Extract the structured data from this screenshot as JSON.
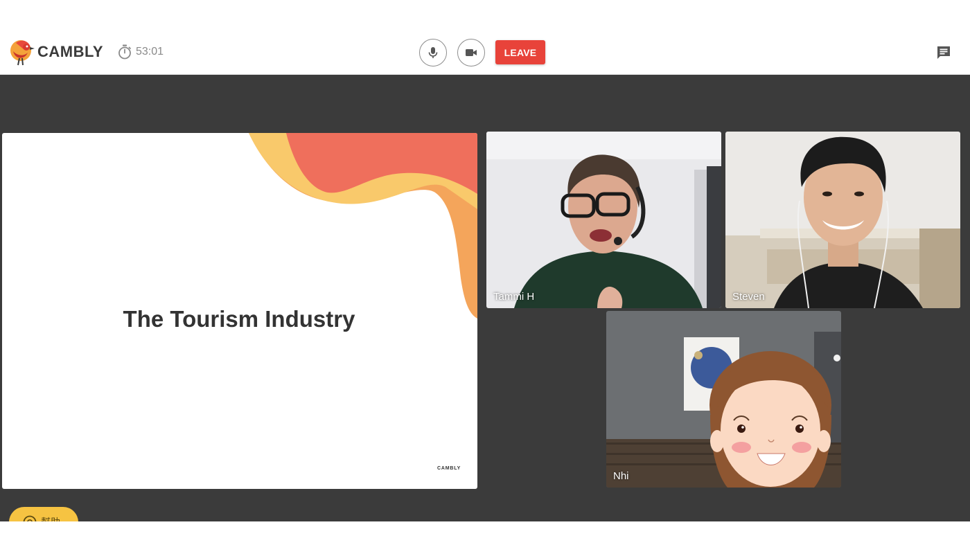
{
  "app": {
    "brand": "CAMBLY",
    "timer": "53:01"
  },
  "controls": {
    "leave_label": "LEAVE"
  },
  "slide": {
    "title": "The Tourism Industry",
    "footer_brand": "CAMBLY",
    "accent_colors": [
      "#f9c96b",
      "#ef6f5c",
      "#f4a55b"
    ]
  },
  "participants": [
    {
      "name": "Tammi H"
    },
    {
      "name": "Steven"
    },
    {
      "name": "Nhi"
    }
  ],
  "help": {
    "label": "幫助"
  },
  "colors": {
    "leave": "#e8433a",
    "stage": "#3b3b3b",
    "help": "#f6c342"
  },
  "icons": [
    "timer-icon",
    "microphone-icon",
    "video-camera-icon",
    "chat-icon",
    "help-icon"
  ]
}
